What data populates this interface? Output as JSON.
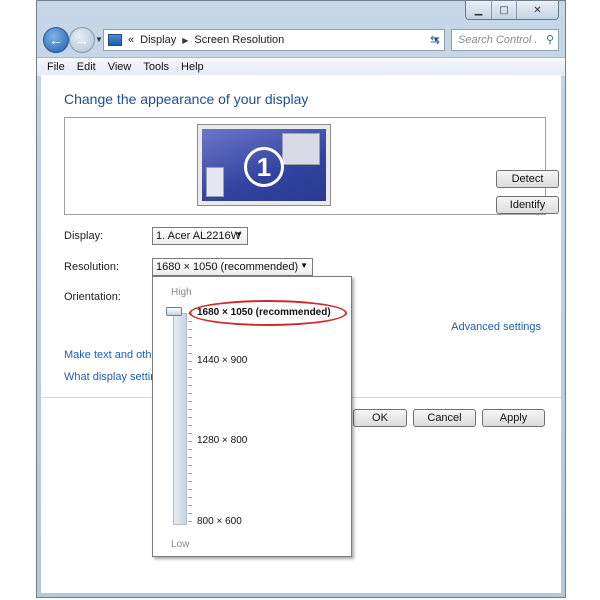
{
  "window": {
    "controls": {
      "minimize": "▁",
      "maximize": "□",
      "close": "✕"
    }
  },
  "navbar": {
    "back_icon": "←",
    "forward_icon": "→",
    "address_prefix": "«",
    "breadcrumb": [
      "Display",
      "Screen Resolution"
    ],
    "search_placeholder": "Search Control ..."
  },
  "menubar": {
    "items": [
      "File",
      "Edit",
      "View",
      "Tools",
      "Help"
    ]
  },
  "main": {
    "heading": "Change the appearance of your display",
    "monitor_number": "1",
    "detect_label": "Detect",
    "identify_label": "Identify",
    "display_label": "Display:",
    "display_value": "1. Acer AL2216W",
    "resolution_label": "Resolution:",
    "resolution_value": "1680 × 1050 (recommended)",
    "orientation_label": "Orientation:",
    "advanced_link": "Advanced settings",
    "link_make_text": "Make text and other",
    "link_what_display": "What display setting",
    "ok_label": "OK",
    "cancel_label": "Cancel",
    "apply_label": "Apply"
  },
  "resolution_dropdown": {
    "high_label": "High",
    "low_label": "Low",
    "options": [
      "1680 × 1050 (recommended)",
      "1440 × 900",
      "1280 × 800",
      "800 × 600"
    ],
    "selected": "1680 × 1050 (recommended)",
    "highlight_color": "#d12a2a"
  }
}
